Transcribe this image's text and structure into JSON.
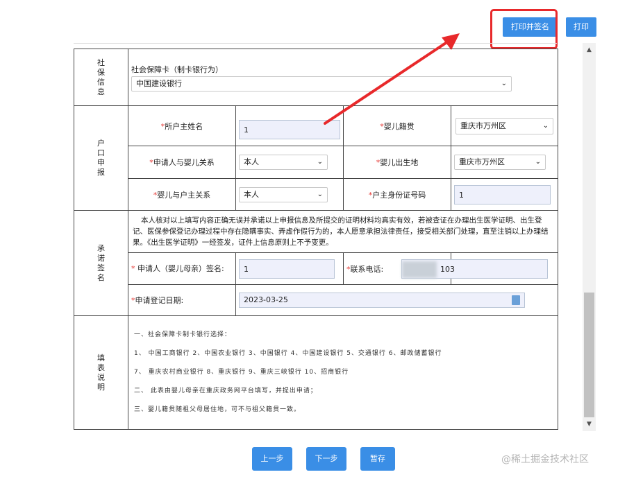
{
  "toolbar": {
    "print_sign_label": "打印并签名",
    "print_label": "打印"
  },
  "social": {
    "section": "社保信息",
    "card_label": "社会保障卡（制卡银行为）",
    "bank_value": "中国建设银行"
  },
  "household": {
    "section": "户口申报",
    "head_name_label": "所户主姓名",
    "head_name_value": "1",
    "baby_origin_label": "婴儿籍贯",
    "baby_origin_value": "重庆市万州区",
    "applicant_relation_label": "申请人与婴儿关系",
    "applicant_relation_value": "本人",
    "baby_birthplace_label": "婴儿出生地",
    "baby_birthplace_value": "重庆市万州区",
    "baby_head_relation_label": "婴儿与户主关系",
    "baby_head_relation_value": "本人",
    "head_id_label": "户主身份证号码",
    "head_id_value": "1"
  },
  "pledge": {
    "section": "承诺签名",
    "notice": "本人核对以上填写内容正确无误并承诺以上申报信息及所提交的证明材料均真实有效，若被查证在办理出生医学证明、出生登记、医保参保登记办理过程中存在隐瞒事实、弄虚作假行为的，本人愿意承担法律责任，接受相关部门处理，直至注销以上办理结果。《出生医学证明》一经签发，证件上信息原则上不予变更。",
    "applicant_sign_label": "申请人（婴儿母亲）签名:",
    "applicant_sign_value": "1",
    "phone_label": "联系电话:",
    "phone_value": "103",
    "date_label": "申请登记日期:",
    "date_value": "2023-03-25"
  },
  "instructions": {
    "section": "填表说明",
    "lines": [
      "一、社会保障卡制卡银行选择：",
      "1、 中国工商银行  2、中国农业银行  3、中国银行  4、中国建设银行   5、交通银行  6、邮政储蓄银行",
      "7、 重庆农村商业银行   8、重庆银行      9、重庆三峡银行   10、招商银行",
      "二、 此表由婴儿母亲在重庆政务网平台填写，并提出申请；",
      "三、婴儿籍贯随祖父母居住地，可不与祖父籍贯一致。"
    ]
  },
  "footer": {
    "prev_label": "上一步",
    "next_label": "下一步",
    "save_label": "暂存"
  },
  "watermark": "@稀土掘金技术社区",
  "colors": {
    "accent": "#3a8ee6",
    "highlight": "#e8292b",
    "required": "#e53935"
  }
}
